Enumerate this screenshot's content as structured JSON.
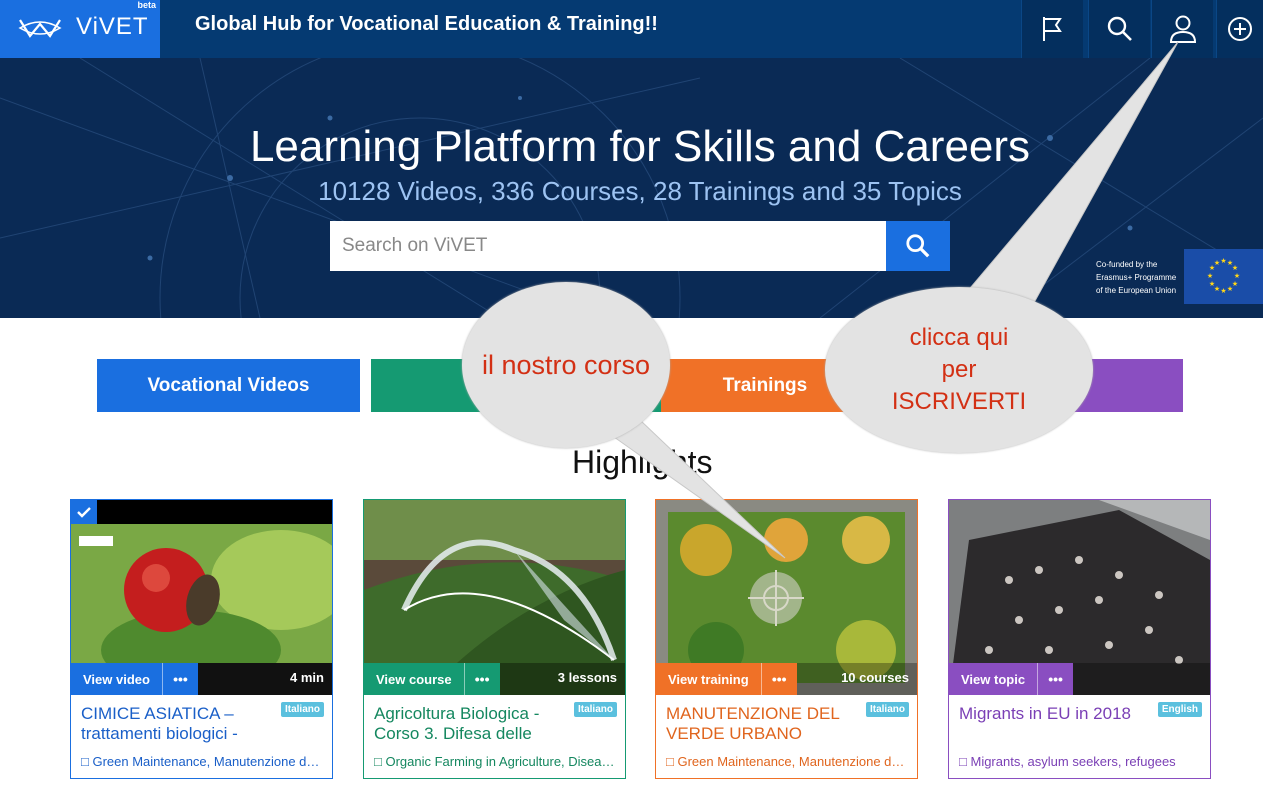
{
  "header": {
    "brand": "ViVET",
    "beta": "beta",
    "tagline": "Global Hub for Vocational Education & Training!!",
    "icons": [
      "flag-icon",
      "search-icon",
      "user-icon",
      "plus-circle-icon"
    ]
  },
  "hero": {
    "title": "Learning Platform for Skills and Careers",
    "subtitle": "10128 Videos, 336 Courses, 28 Trainings and 35 Topics",
    "search_placeholder": "Search on ViVET",
    "cofunded": [
      "Co-funded by the",
      "Erasmus+ Programme",
      "of the European Union"
    ]
  },
  "categories": [
    {
      "label": "Vocational Videos",
      "color": "#1a6fe0"
    },
    {
      "label": "",
      "color": "#159a72"
    },
    {
      "label": "Trainings",
      "color": "#f07127"
    },
    {
      "label": "",
      "color": "#8a4ec1"
    }
  ],
  "highlights_heading": "Highlights",
  "cards": [
    {
      "action": "View video",
      "meta": "4 min",
      "title": "CIMICE ASIATICA – trattamenti biologici -",
      "lang": "Italiano",
      "tags": "Green Maintenance, Manutenzione del …",
      "color": "#1a6fe0",
      "text_color": "#1a5fc8"
    },
    {
      "action": "View course",
      "meta": "3 lessons",
      "title": "Agricoltura Biologica - Corso 3. Difesa delle",
      "lang": "Italiano",
      "tags": "Organic Farming in Agriculture, Disease…",
      "color": "#159a72",
      "text_color": "#14875f"
    },
    {
      "action": "View training",
      "meta": "10 courses",
      "title": "MANUTENZIONE DEL VERDE URBANO",
      "lang": "Italiano",
      "tags": "Green Maintenance, Manutenzione del …",
      "color": "#f07127",
      "text_color": "#e0651e"
    },
    {
      "action": "View topic",
      "meta": "",
      "title": "Migrants in EU in 2018",
      "lang": "English",
      "tags": "Migrants, asylum seekers, refugees",
      "color": "#8a4ec1",
      "text_color": "#7a3fb5"
    }
  ],
  "more_glyph": "•••",
  "annotations": {
    "bubble1": "il nostro corso",
    "bubble2": [
      "clicca qui",
      "per",
      "ISCRIVERTI"
    ]
  }
}
